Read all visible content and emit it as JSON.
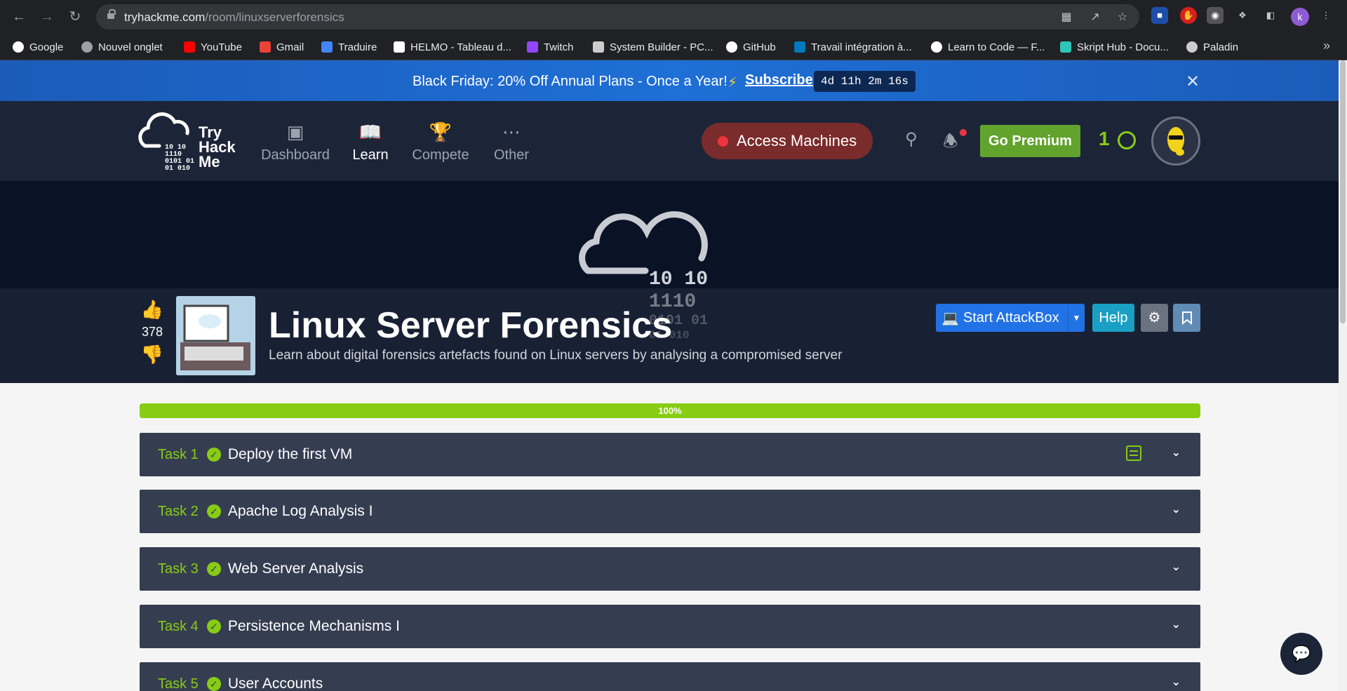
{
  "browser": {
    "url_host": "tryhackme.com",
    "url_path": "/room/linuxserverforensics",
    "profile_initial": "k",
    "bookmarks": [
      {
        "label": "Google",
        "color": "#4285f4"
      },
      {
        "label": "Nouvel onglet",
        "color": "#9aa0a6"
      },
      {
        "label": "YouTube",
        "color": "#ff0000"
      },
      {
        "label": "Gmail",
        "color": "#ea4335"
      },
      {
        "label": "Traduire",
        "color": "#4285f4"
      },
      {
        "label": "HELMO - Tableau d...",
        "color": "#ffffff"
      },
      {
        "label": "Twitch",
        "color": "#9146ff"
      },
      {
        "label": "System Builder - PC...",
        "color": "#cccccc"
      },
      {
        "label": "GitHub",
        "color": "#ffffff"
      },
      {
        "label": "Travail intégration à...",
        "color": "#0079bf"
      },
      {
        "label": "Learn to Code — F...",
        "color": "#ffffff"
      },
      {
        "label": "Skript Hub - Docu...",
        "color": "#2ec4b6"
      },
      {
        "label": "Paladin",
        "color": "#cccccc"
      }
    ]
  },
  "promo": {
    "text": "Black Friday: 20% Off Annual Plans - Once a Year!",
    "subscribe": "Subscribe",
    "timer": "4d 11h 2m 16s"
  },
  "header": {
    "logo": {
      "line1": "Try",
      "line2": "Hack",
      "line3": "Me",
      "bits1": "10  10",
      "bits2": "1110",
      "bits3": "0101  01",
      "bits4": "01   010",
      "bits5": "01"
    },
    "nav": [
      {
        "label": "Dashboard",
        "icon": "dashboard-icon",
        "active": false
      },
      {
        "label": "Learn",
        "icon": "book-icon",
        "active": true
      },
      {
        "label": "Compete",
        "icon": "trophy-icon",
        "active": false
      },
      {
        "label": "Other",
        "icon": "more-icon",
        "active": false
      }
    ],
    "access_machines": "Access Machines",
    "go_premium": "Go Premium",
    "streak": "1"
  },
  "room": {
    "hero_bits": {
      "b1": "10  10",
      "b2": "1110",
      "b3": "0101  01",
      "b4": "01    010",
      "b5": "01"
    },
    "upvotes": "378",
    "title": "Linux Server Forensics",
    "subtitle": "Learn about digital forensics artefacts found on Linux servers by analysing a compromised server",
    "start_attackbox": "Start AttackBox",
    "help": "Help"
  },
  "progress": {
    "label": "100%",
    "value": 100
  },
  "tasks": [
    {
      "number": "Task 1",
      "title": "Deploy the first VM",
      "completed": true
    },
    {
      "number": "Task 2",
      "title": "Apache Log Analysis I",
      "completed": true
    },
    {
      "number": "Task 3",
      "title": "Web Server Analysis",
      "completed": true
    },
    {
      "number": "Task 4",
      "title": "Persistence Mechanisms I",
      "completed": true
    },
    {
      "number": "Task 5",
      "title": "User Accounts",
      "completed": true
    }
  ],
  "colors": {
    "accent": "#88cc14",
    "header_bg": "#1c2538",
    "task_bg": "#353d51",
    "promo_bg": "#1e6fd6"
  }
}
